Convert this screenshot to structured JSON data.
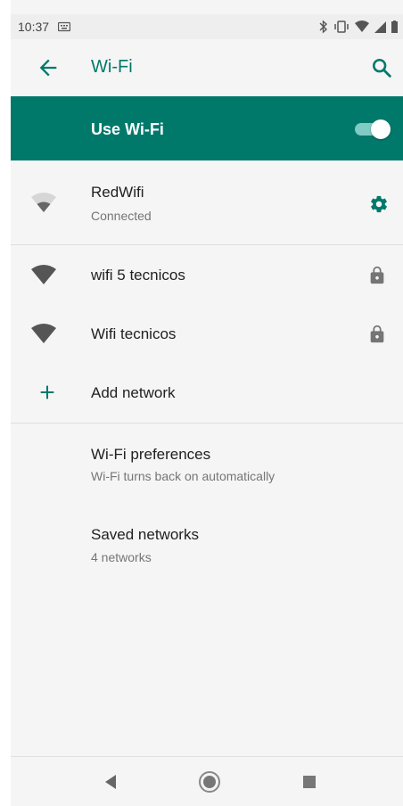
{
  "status_bar": {
    "time": "10:37",
    "icons": [
      "keyboard-icon",
      "bluetooth-icon",
      "vibrate-icon",
      "wifi-status-icon",
      "cellular-signal-icon",
      "battery-icon"
    ]
  },
  "app_bar": {
    "title": "Wi-Fi",
    "back_icon": "arrow-back-icon",
    "search_icon": "search-icon"
  },
  "use_wifi": {
    "label": "Use Wi-Fi",
    "enabled": true
  },
  "connected_network": {
    "name": "RedWifi",
    "status": "Connected",
    "icon": "wifi-signal-icon",
    "settings_icon": "gear-icon"
  },
  "networks": [
    {
      "name": "wifi 5 tecnicos",
      "secured": true
    },
    {
      "name": "Wifi tecnicos",
      "secured": true
    }
  ],
  "add_network": {
    "label": "Add network",
    "icon": "plus-icon"
  },
  "preferences": {
    "title": "Wi-Fi preferences",
    "subtitle": "Wi-Fi turns back on automatically"
  },
  "saved_networks": {
    "title": "Saved networks",
    "subtitle": "4 networks"
  },
  "colors": {
    "accent": "#00796b",
    "background": "#f5f5f5",
    "toggle_track": "#80cbc4"
  },
  "nav_bar": [
    "back-nav-icon",
    "home-nav-icon",
    "recents-nav-icon"
  ]
}
